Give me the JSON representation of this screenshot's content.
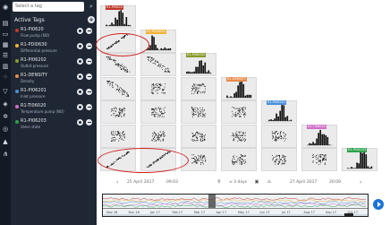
{
  "search": {
    "placeholder": "Select a tag"
  },
  "panel": {
    "header": "Active Tags"
  },
  "tags": [
    {
      "id": "R1-PI0620",
      "desc": "Flow pump (NO)",
      "color": "#c0392b"
    },
    {
      "id": "R1-PDI0630",
      "desc": "Differential pressure",
      "color": "#f0b23a"
    },
    {
      "id": "R1-PI06202",
      "desc": "Outlet pressure",
      "color": "#8a9a2a"
    },
    {
      "id": "R1-DENSITY",
      "desc": "Density",
      "color": "#e88b4a"
    },
    {
      "id": "R1-PI06201",
      "desc": "Inlet pressure",
      "color": "#4a90d9"
    },
    {
      "id": "R1-TI06020",
      "desc": "Temperature pump (NO)",
      "color": "#d070c8"
    },
    {
      "id": "R1-PI06203",
      "desc": "Valve state",
      "color": "#2ea24a"
    }
  ],
  "matrix": {
    "diagonal_labels": [
      "R1-PI0620",
      "R1-PDI0630",
      "R1-PI06202",
      "R1-DENSITY",
      "R1-PI06201",
      "R1-TI06020",
      "R1-PI06203"
    ],
    "diagonal_colors": [
      "#c0392b",
      "#f0b23a",
      "#8a9a2a",
      "#e88b4a",
      "#4a90d9",
      "#d070c8",
      "#2ea24a"
    ]
  },
  "timebar": {
    "start": "25 April 2017",
    "start_time": "09:03",
    "range": "± 3 days",
    "end": "27 April 2017",
    "end_time": "20:09"
  },
  "timeline": {
    "months": [
      "Nov 16",
      "Dec 16",
      "Jan 17",
      "Feb 17",
      "Mar 17",
      "Apr 17",
      "May 17",
      "Jun 17",
      "Jul 17",
      "Aug 17",
      "Sep 17",
      "Oct 17"
    ]
  },
  "icons": [
    "menu-icon",
    "search-icon",
    "add-icon",
    "eye-icon",
    "remove-icon",
    "play-icon"
  ]
}
